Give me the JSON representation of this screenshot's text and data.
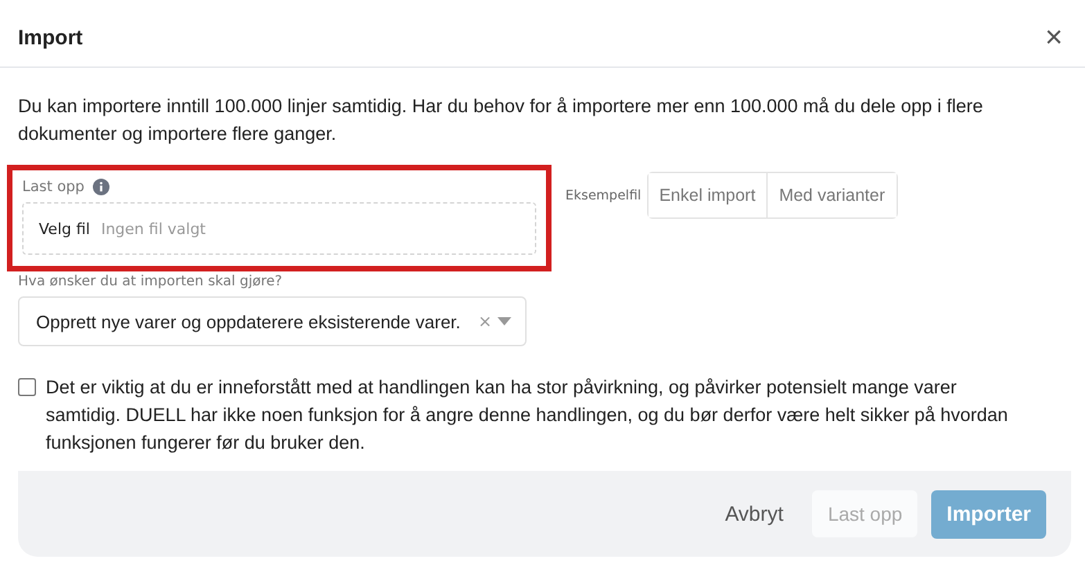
{
  "window": {
    "title": "Import",
    "close": "×"
  },
  "intro": "Du kan importere inntill 100.000 linjer samtidig. Har du behov for å importere mer enn 100.000 må du dele opp i flere dokumenter og importere flere ganger.",
  "upload": {
    "label": "Last opp",
    "highlighted": true,
    "button": "Velg fil",
    "status": "Ingen fil valgt"
  },
  "sample_files": {
    "label": "Eksempelfil",
    "buttons": [
      "Enkel import",
      "Med varianter"
    ]
  },
  "action_select": {
    "label": "Hva ønsker du at importen skal gjøre?",
    "value": "Opprett nye varer og oppdaterere eksisterende varer.",
    "clear": "×"
  },
  "confirm": {
    "checked": false,
    "text": "Det er viktig at du er inneforstått med at handlingen kan ha stor påvirkning, og påvirker potensielt mange varer samtidig. DUELL har ikke noen funksjon for å angre denne handlingen, og du bør derfor være helt sikker på hvordan funksjonen fungerer før du bruker den."
  },
  "footer": {
    "buttons": [
      {
        "label": "Avbryt",
        "kind": "link",
        "disabled": false
      },
      {
        "label": "Last opp",
        "kind": "secondary",
        "disabled": true
      },
      {
        "label": "Importer",
        "kind": "primary",
        "disabled": true
      }
    ]
  }
}
